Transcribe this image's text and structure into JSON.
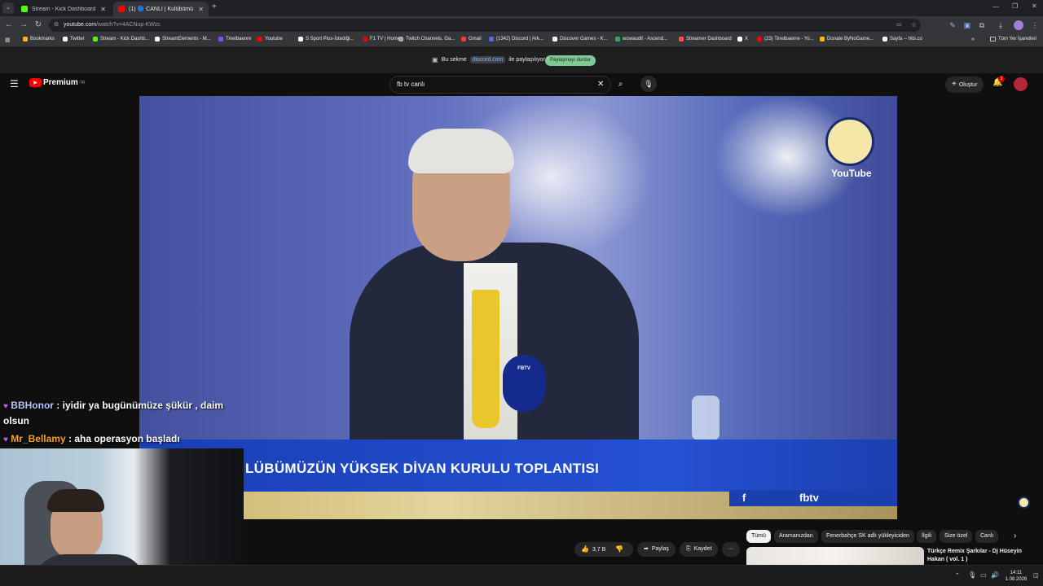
{
  "browser": {
    "tabs": [
      {
        "title": "Stream - Kick Dashboard",
        "color": "#53fc18",
        "active": false
      },
      {
        "title": "(1) 🔵 CANLI | Kulübümüz...",
        "color": "#ff0000",
        "active": true
      }
    ],
    "new_tab": "+",
    "url_host": "youtube.com",
    "url_path": "/watch?v=4ACNup-KWzc"
  },
  "bookmarks": [
    {
      "label": "Bookmarks",
      "color": "#fbbc04"
    },
    {
      "label": "Twitter",
      "color": "#ffffff"
    },
    {
      "label": "Stream - Kick Dashb...",
      "color": "#53fc18"
    },
    {
      "label": "StreamElements - M...",
      "color": "#ffffff"
    },
    {
      "label": "Tinelbaenre",
      "color": "#9146ff"
    },
    {
      "label": "Youtube",
      "color": "#ff0000"
    },
    {
      "label": "S Sport Plus-İstediği...",
      "color": "#ffffff"
    },
    {
      "label": "F1 TV | Home",
      "color": "#e10600"
    },
    {
      "label": "Twitch Channels, Ga...",
      "color": "#aaaaaa"
    },
    {
      "label": "Gmail",
      "color": "#ea4335"
    },
    {
      "label": "(1342) Discord | Ark...",
      "color": "#5865f2"
    },
    {
      "label": "Discover Games - K...",
      "color": "#ffffff"
    },
    {
      "label": "wowaudit - Ascend...",
      "color": "#34a853"
    },
    {
      "label": "Streamer Dashboard",
      "color": "#ff4f4f"
    },
    {
      "label": "X",
      "color": "#ffffff"
    },
    {
      "label": "(23) Tinelbaenre - Yo...",
      "color": "#ff0000"
    },
    {
      "label": "Donate ByNoGame...",
      "color": "#fbbc04"
    },
    {
      "label": "Sayfa -- hits.co",
      "color": "#ffffff"
    }
  ],
  "bookmarks_more": "»",
  "bookmarks_all": "Tüm Yer İşaretleri",
  "share": {
    "prefix": "Bu sekme",
    "site": "discord.com",
    "suffix": "ile paylaşılıyor",
    "stop_label": "Paylaşmayı durdur"
  },
  "youtube": {
    "logo": "Premium",
    "logo_sup": "TR",
    "search_value": "fb tv canlı",
    "create_label": "Oluştur",
    "notif_count": "1"
  },
  "video": {
    "lower_third": "LÜBÜMÜZÜN YÜKSEK DİVAN KURULU TOPLANTISI",
    "watermark": "YouTube",
    "brand": "fbtv",
    "mic_label": "FBTV"
  },
  "chat": [
    {
      "user": "BBHonor",
      "text": ": iyidir ya bugünümüze şükür , daim",
      "cont": "olsun"
    },
    {
      "user": "Mr_Bellamy",
      "text": ": aha operasyon başladı"
    }
  ],
  "actions": {
    "likes": "3,7 B",
    "share": "Paylaş",
    "save": "Kaydet",
    "more": "···"
  },
  "chips": [
    "Tümü",
    "Aramanızdan",
    "Fenerbahçe SK adlı yükleyiciden",
    "İlgili",
    "Size özel",
    "Canlı"
  ],
  "rec": {
    "title": "Türkçe Remix Şarkılar - Dj Hüseyin Hakan ( vol. 1 )"
  },
  "taskbar": {
    "time": "14:11",
    "date": "1.08.2026"
  }
}
